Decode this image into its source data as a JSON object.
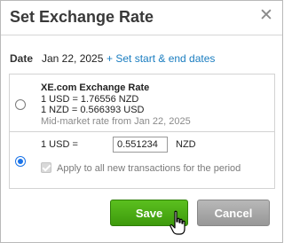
{
  "dialog": {
    "title": "Set Exchange Rate",
    "close_icon": "close-icon"
  },
  "date": {
    "label": "Date",
    "value": "Jan 22, 2025",
    "link": "+ Set start & end dates"
  },
  "options": {
    "xe": {
      "selected": false,
      "title": "XE.com Exchange Rate",
      "rate1": "1 USD = 1.76556 NZD",
      "rate2": "1 NZD = 0.566393 USD",
      "note": "Mid-market rate from Jan 22, 2025"
    },
    "custom": {
      "selected": true,
      "prefix": "1 USD =",
      "value": "0.551234",
      "currency": "NZD",
      "apply_all_label": "Apply to all new transactions for the period",
      "apply_all_checked": true,
      "apply_all_disabled": true
    }
  },
  "buttons": {
    "save": "Save",
    "cancel": "Cancel"
  },
  "colors": {
    "save_green": "#4aab15",
    "cancel_gray": "#a8a8a8",
    "link_blue": "#1a7dc0",
    "radio_blue": "#1a73e8"
  }
}
